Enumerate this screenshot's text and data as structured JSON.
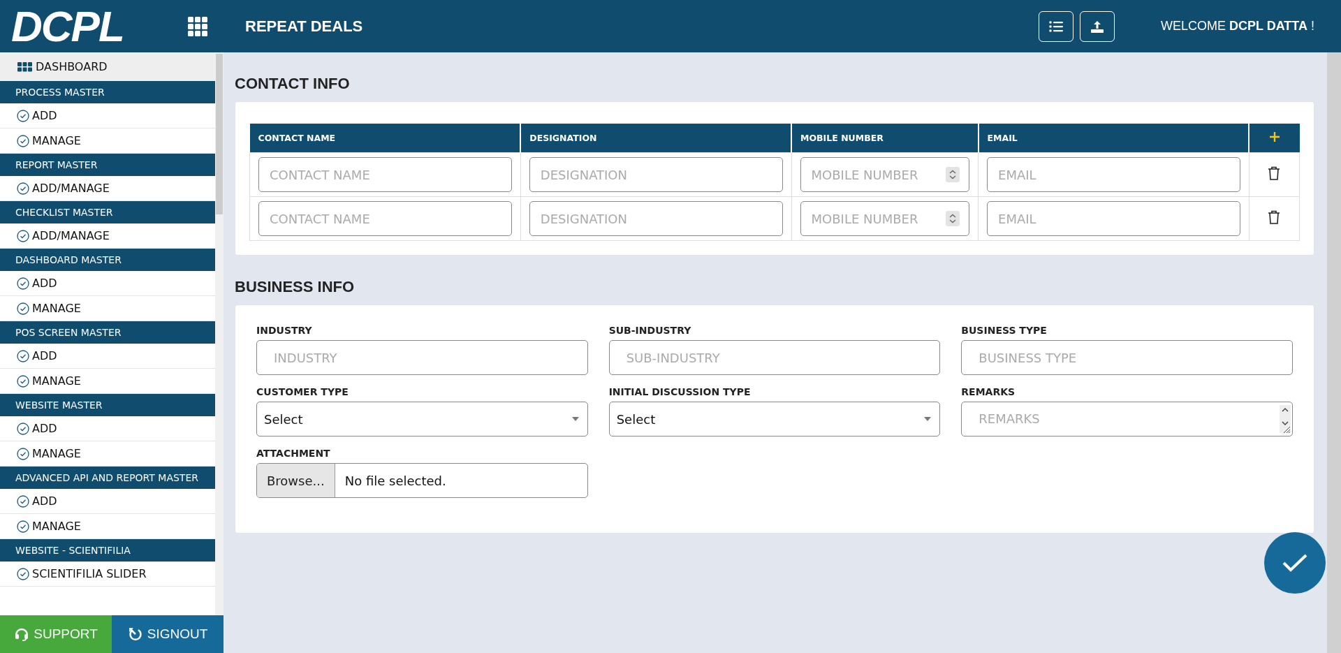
{
  "header": {
    "logo": "DCPL",
    "title": "REPEAT DEALS",
    "welcome": "WELCOME **DCPL DATTA** !"
  },
  "sidebar": {
    "dashboard": {
      "label": "DASHBOARD",
      "selected": true
    },
    "sections": [
      {
        "title": "PROCESS MASTER",
        "items": [
          "ADD",
          "MANAGE"
        ]
      },
      {
        "title": "REPORT MASTER",
        "items": [
          "ADD/MANAGE"
        ]
      },
      {
        "title": "CHECKLIST MASTER",
        "items": [
          "ADD/MANAGE"
        ]
      },
      {
        "title": "DASHBOARD MASTER",
        "items": [
          "ADD",
          "MANAGE"
        ]
      },
      {
        "title": "POS SCREEN MASTER",
        "items": [
          "ADD",
          "MANAGE"
        ]
      },
      {
        "title": "WEBSITE MASTER",
        "items": [
          "ADD",
          "MANAGE"
        ]
      },
      {
        "title": "ADVANCED API AND REPORT MASTER",
        "items": [
          "ADD",
          "MANAGE"
        ]
      },
      {
        "title": "WEBSITE - SCIENTIFILIA",
        "items": [
          "SCIENTIFILIA SLIDER"
        ]
      }
    ],
    "footer": [
      {
        "kind": "support",
        "label": "SUPPORT"
      },
      {
        "kind": "signout",
        "label": "SIGNOUT"
      }
    ]
  },
  "contact_info": {
    "title": "CONTACT INFO",
    "columns": [
      "CONTACT NAME",
      "DESIGNATION",
      "MOBILE NUMBER",
      "EMAIL"
    ],
    "rows": [
      {
        "fields": [
          {
            "kind": "text",
            "placeholder": "CONTACT NAME"
          },
          {
            "kind": "text",
            "placeholder": "DESIGNATION"
          },
          {
            "kind": "number",
            "placeholder": "MOBILE NUMBER"
          },
          {
            "kind": "text",
            "placeholder": "EMAIL"
          }
        ]
      },
      {
        "fields": [
          {
            "kind": "text",
            "placeholder": "CONTACT NAME"
          },
          {
            "kind": "text",
            "placeholder": "DESIGNATION"
          },
          {
            "kind": "number",
            "placeholder": "MOBILE NUMBER"
          },
          {
            "kind": "text",
            "placeholder": "EMAIL"
          }
        ]
      }
    ]
  },
  "business_info": {
    "title": "BUSINESS INFO",
    "fields": [
      {
        "kind": "text",
        "label": "INDUSTRY",
        "placeholder": "INDUSTRY"
      },
      {
        "kind": "text",
        "label": "SUB-INDUSTRY",
        "placeholder": "SUB-INDUSTRY"
      },
      {
        "kind": "text",
        "label": "BUSINESS TYPE",
        "placeholder": "BUSINESS TYPE"
      },
      {
        "kind": "select",
        "label": "CUSTOMER TYPE",
        "value": "Select"
      },
      {
        "kind": "select",
        "label": "INITIAL DISCUSSION TYPE",
        "value": "Select"
      },
      {
        "kind": "textarea",
        "label": "REMARKS",
        "placeholder": "REMARKS"
      },
      {
        "kind": "file",
        "label": "ATTACHMENT",
        "button": "Browse...",
        "value": "No file selected."
      }
    ]
  }
}
